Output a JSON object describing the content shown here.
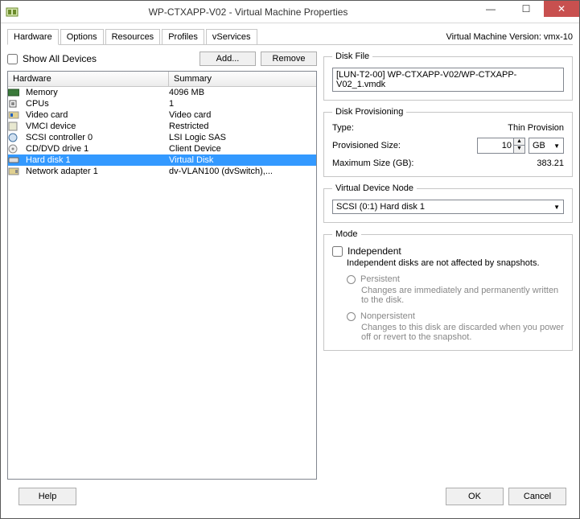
{
  "window": {
    "title": "WP-CTXAPP-V02 - Virtual Machine Properties"
  },
  "tabs": {
    "items": [
      "Hardware",
      "Options",
      "Resources",
      "Profiles",
      "vServices"
    ],
    "vm_version": "Virtual Machine Version: vmx-10"
  },
  "controls": {
    "show_all": "Show All Devices",
    "add": "Add...",
    "remove": "Remove"
  },
  "hw_headers": {
    "c1": "Hardware",
    "c2": "Summary"
  },
  "hw": [
    {
      "icon": "memory-icon",
      "name": "Memory",
      "summary": "4096 MB"
    },
    {
      "icon": "cpu-icon",
      "name": "CPUs",
      "summary": "1"
    },
    {
      "icon": "video-icon",
      "name": "Video card",
      "summary": "Video card"
    },
    {
      "icon": "vmci-icon",
      "name": "VMCI device",
      "summary": "Restricted"
    },
    {
      "icon": "scsi-icon",
      "name": "SCSI controller 0",
      "summary": "LSI Logic SAS"
    },
    {
      "icon": "cd-icon",
      "name": "CD/DVD drive 1",
      "summary": "Client Device"
    },
    {
      "icon": "disk-icon",
      "name": "Hard disk 1",
      "summary": "Virtual Disk"
    },
    {
      "icon": "nic-icon",
      "name": "Network adapter 1",
      "summary": "dv-VLAN100 (dvSwitch),..."
    }
  ],
  "disk_file": {
    "legend": "Disk File",
    "value": "[LUN-T2-00] WP-CTXAPP-V02/WP-CTXAPP-V02_1.vmdk"
  },
  "prov": {
    "legend": "Disk Provisioning",
    "type_lbl": "Type:",
    "type_val": "Thin Provision",
    "size_lbl": "Provisioned Size:",
    "size_val": "10",
    "unit": "GB",
    "max_lbl": "Maximum Size (GB):",
    "max_val": "383.21"
  },
  "vnode": {
    "legend": "Virtual Device Node",
    "value": "SCSI (0:1) Hard disk 1"
  },
  "mode": {
    "legend": "Mode",
    "independent": "Independent",
    "ind_desc": "Independent disks are not affected by snapshots.",
    "persistent": "Persistent",
    "p_desc": "Changes are immediately and permanently written to the disk.",
    "nonpersistent": "Nonpersistent",
    "np_desc": "Changes to this disk are discarded when you power off or revert to the snapshot."
  },
  "footer": {
    "help": "Help",
    "ok": "OK",
    "cancel": "Cancel"
  }
}
